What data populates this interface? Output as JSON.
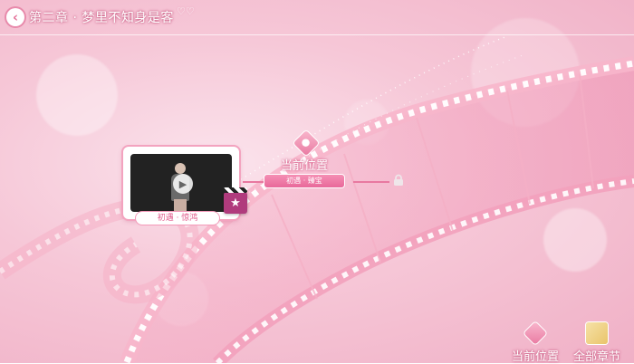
{
  "header": {
    "back_icon": "chevron-left-icon",
    "chapter_title": "第二章 · 梦里不知身是客",
    "decoration": "♡♡"
  },
  "map": {
    "nodes": [
      {
        "label": "初遇 · 惊鸿",
        "state": "unlocked",
        "thumbnail_icon": "play-icon",
        "badge_icon": "clapperboard-icon"
      },
      {
        "label": "初遇 · 臻宝",
        "state": "current"
      },
      {
        "state": "locked",
        "icon": "lock-icon"
      }
    ],
    "current_marker": "当前位置"
  },
  "bottom_bar": {
    "current_position_label": "当前位置",
    "all_chapters_label": "全部章节"
  },
  "colors": {
    "accent": "#e8689a",
    "background": "#f6c7d7"
  }
}
